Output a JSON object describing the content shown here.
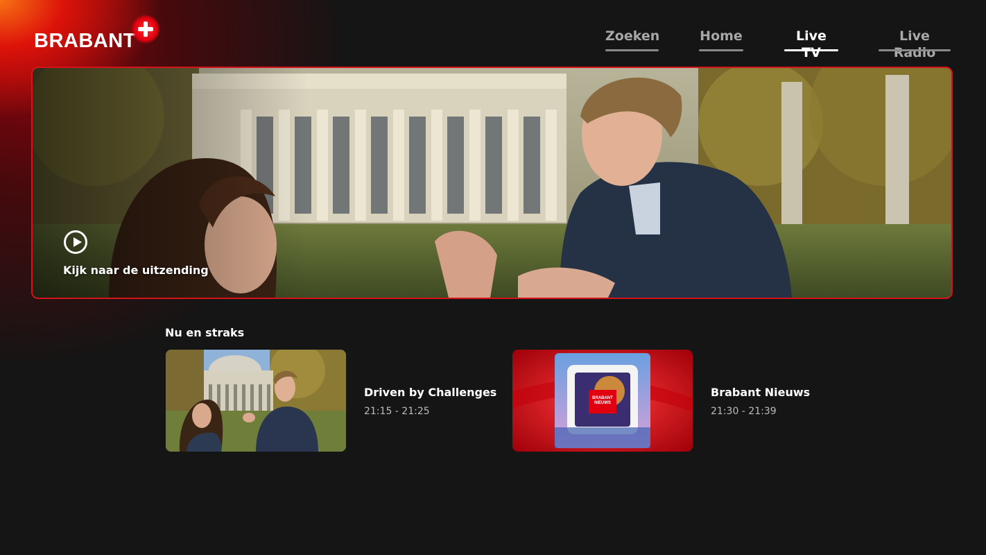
{
  "brand": {
    "logo_text": "BRABANT",
    "accent": "#e1000f"
  },
  "nav": {
    "items": [
      {
        "label": "Zoeken",
        "active": false
      },
      {
        "label": "Home",
        "active": false
      },
      {
        "label": "Live TV",
        "active": true
      },
      {
        "label": "Live Radio",
        "active": false
      }
    ]
  },
  "hero": {
    "cta_label": "Kijk naar de uitzending",
    "play_icon": "play-circle-icon"
  },
  "schedule": {
    "title": "Nu en straks",
    "items": [
      {
        "title": "Driven by Challenges",
        "time": "21:15 - 21:25"
      },
      {
        "title": "Brabant Nieuws",
        "time": "21:30 - 21:39",
        "thumb_logo_line1": "BRABANT",
        "thumb_logo_line2": "NIEUWS"
      }
    ]
  }
}
